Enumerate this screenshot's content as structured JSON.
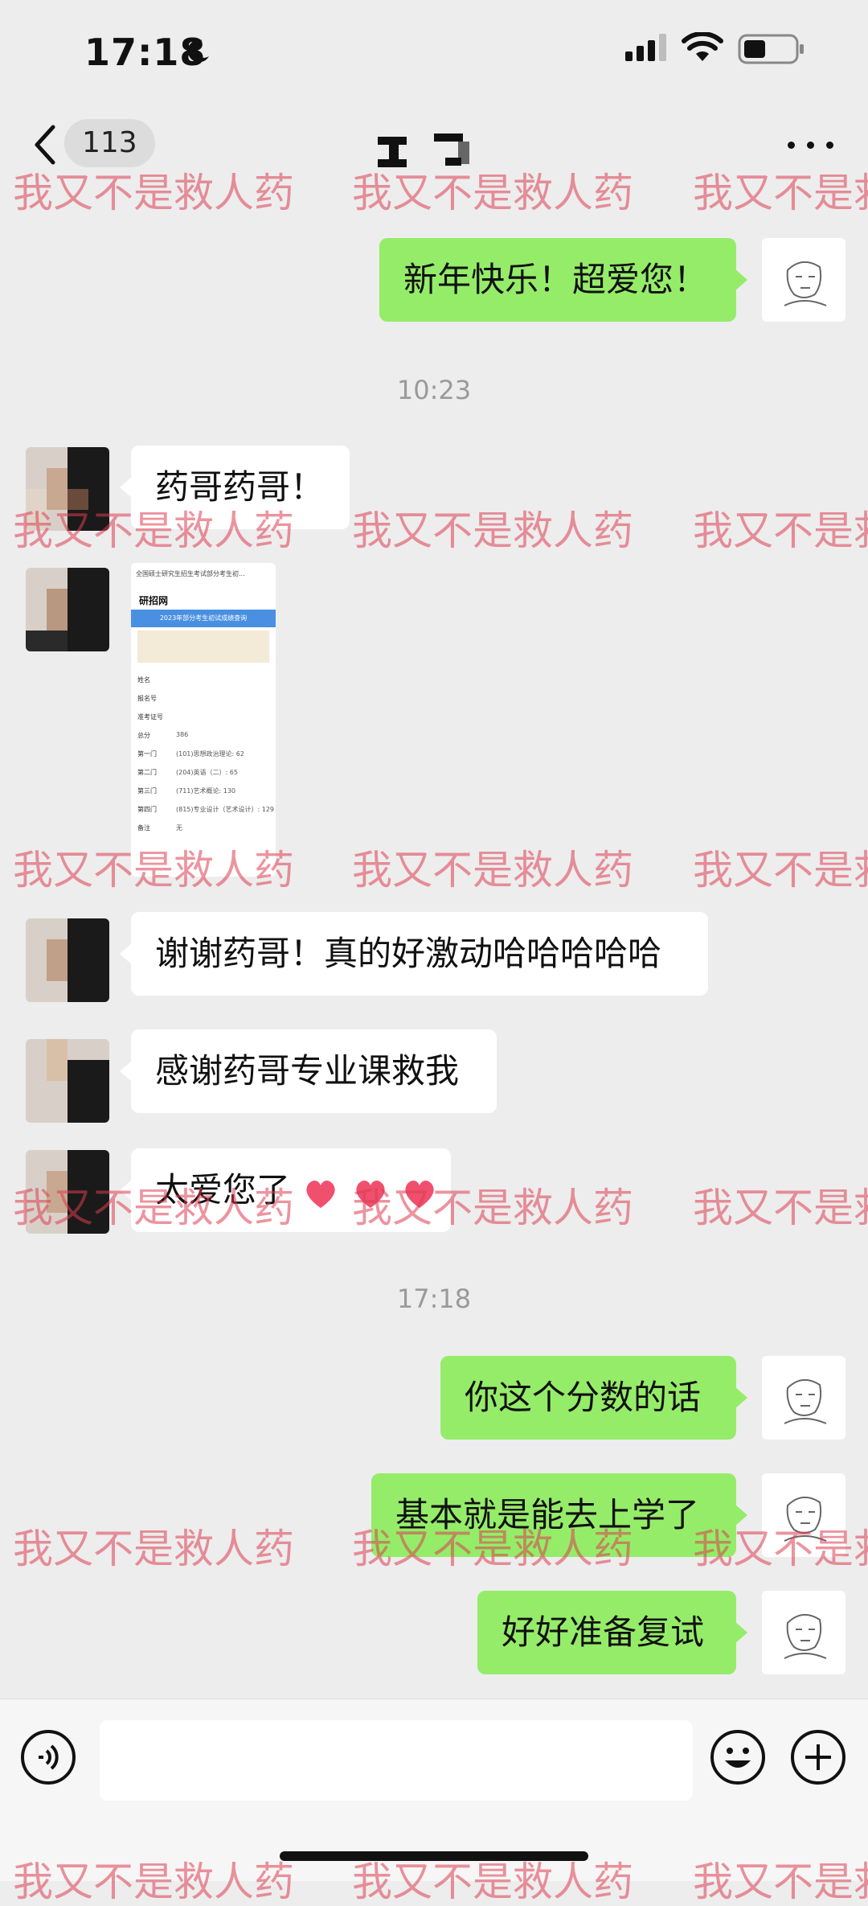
{
  "status_bar": {
    "time": "17:18",
    "icons": [
      "moon-icon",
      "signal-icon",
      "wifi-icon",
      "battery-icon"
    ]
  },
  "nav": {
    "unread_count": "113",
    "icons": [
      "chevron-left-icon",
      "more-icon"
    ]
  },
  "watermark_text": "我又不是救人药",
  "messages": [
    {
      "side": "me",
      "text": "新年快乐！超爱您！"
    },
    {
      "timestamp": "10:23"
    },
    {
      "side": "other",
      "text": "药哥药哥！"
    },
    {
      "side": "other",
      "type": "image",
      "caption": "score screenshot"
    },
    {
      "side": "other",
      "text": "谢谢药哥！真的好激动哈哈哈哈哈"
    },
    {
      "side": "other",
      "text": "感谢药哥专业课救我"
    },
    {
      "side": "other",
      "text": "太爱您了",
      "emoji": [
        "heart",
        "heart",
        "heart"
      ]
    },
    {
      "timestamp": "17:18"
    },
    {
      "side": "me",
      "text": "你这个分数的话"
    },
    {
      "side": "me",
      "text": "基本就是能去上学了"
    },
    {
      "side": "me",
      "text": "好好准备复试"
    }
  ],
  "screenshot": {
    "top_bar": "全国硕士研究生招生考试部分考生初...",
    "brand": "研招网",
    "banner": "2023年部分考生初试成绩查询",
    "rows": [
      {
        "label": "姓名",
        "value": ""
      },
      {
        "label": "报名号",
        "value": ""
      },
      {
        "label": "准考证号",
        "value": ""
      },
      {
        "label": "总分",
        "value": "386"
      },
      {
        "label": "第一门",
        "value": "(101)思想政治理论: 62"
      },
      {
        "label": "第二门",
        "value": "(204)英语（二）: 65"
      },
      {
        "label": "第三门",
        "value": "(711)艺术概论: 130"
      },
      {
        "label": "第四门",
        "value": "(815)专业设计（艺术设计）: 129"
      },
      {
        "label": "备注",
        "value": "无"
      }
    ]
  },
  "colors": {
    "bubble_me": "#95ec69",
    "bubble_other": "#ffffff",
    "background": "#ededed",
    "watermark": "#dc3c50"
  },
  "input_bar": {
    "icons": [
      "voice-icon",
      "emoji-icon",
      "plus-icon"
    ],
    "placeholder": ""
  }
}
